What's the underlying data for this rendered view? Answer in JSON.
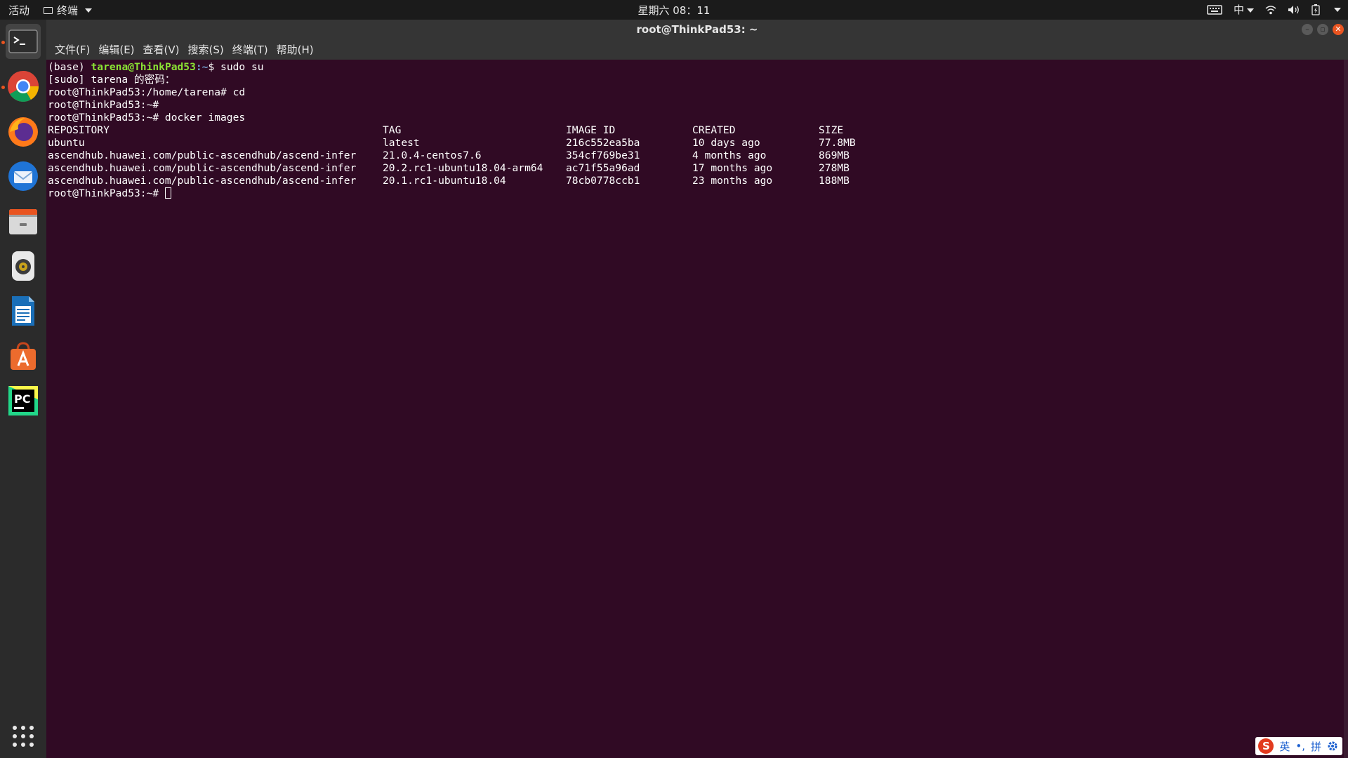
{
  "topbar": {
    "activities": "活动",
    "app_menu": "终端",
    "clock": "星期六 08：11",
    "input_method": "中"
  },
  "window": {
    "title": "root@ThinkPad53: ~"
  },
  "menu": [
    "文件(F)",
    "编辑(E)",
    "查看(V)",
    "搜索(S)",
    "终端(T)",
    "帮助(H)"
  ],
  "terminal": {
    "line1": {
      "prefix": "(base) ",
      "user": "tarena@ThinkPad53",
      "path": ":~",
      "cmd": "$ sudo su"
    },
    "line2": "[sudo] tarena 的密码：",
    "line3": "root@ThinkPad53:/home/tarena# cd",
    "line4": "root@ThinkPad53:~#",
    "line5": "root@ThinkPad53:~# docker images",
    "headers": [
      "REPOSITORY",
      "TAG",
      "IMAGE ID",
      "CREATED",
      "SIZE"
    ],
    "rows": [
      [
        "ubuntu",
        "latest",
        "216c552ea5ba",
        "10 days ago",
        "77.8MB"
      ],
      [
        "ascendhub.huawei.com/public-ascendhub/ascend-infer",
        "21.0.4-centos7.6",
        "354cf769be31",
        "4 months ago",
        "869MB"
      ],
      [
        "ascendhub.huawei.com/public-ascendhub/ascend-infer",
        "20.2.rc1-ubuntu18.04-arm64",
        "ac71f55a96ad",
        "17 months ago",
        "278MB"
      ],
      [
        "ascendhub.huawei.com/public-ascendhub/ascend-infer",
        "20.1.rc1-ubuntu18.04",
        "78cb0778ccb1",
        "23 months ago",
        "188MB"
      ]
    ],
    "last_prompt": "root@ThinkPad53:~# "
  },
  "ime": {
    "logo": "S",
    "lang": "英",
    "punct": "•,",
    "mode": "拼"
  },
  "colors": {
    "terminal_bg": "#300a24",
    "prompt_green": "#8ae234",
    "prompt_blue": "#729fcf",
    "accent": "#e95420"
  }
}
